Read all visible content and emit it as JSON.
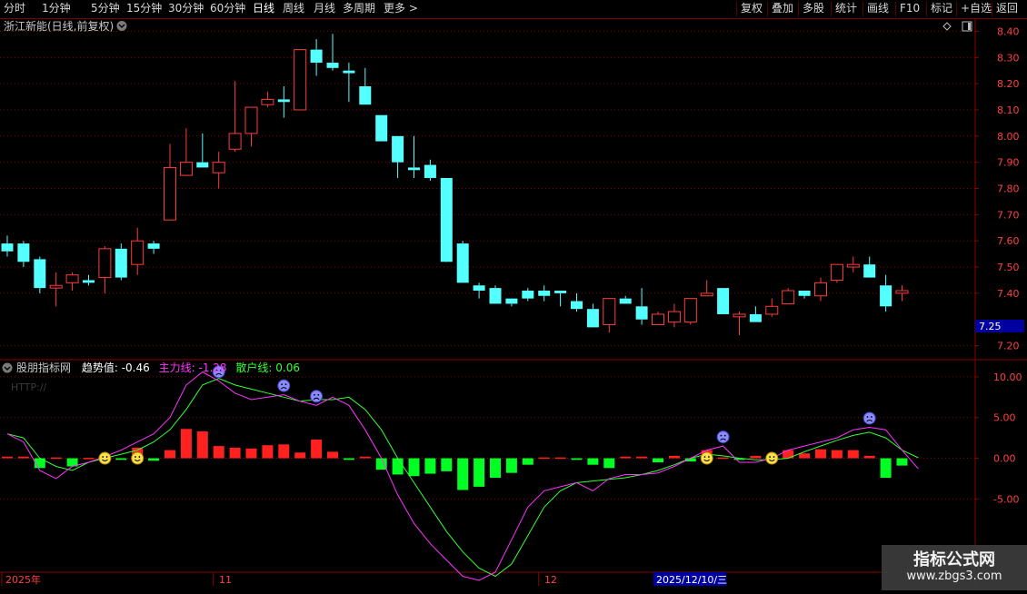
{
  "toolbar": {
    "periods": [
      "分时",
      "1分钟",
      "5分钟",
      "15分钟",
      "30分钟",
      "60分钟",
      "日线",
      "周线",
      "月线",
      "多周期",
      "更多 >"
    ],
    "active_period": "日线",
    "right_buttons": [
      "复权",
      "叠加",
      "多股",
      "统计",
      "画线",
      "F10",
      "标记",
      "+自选",
      "返回"
    ]
  },
  "main_panel": {
    "stock_title": "浙江新能(日线,前复权)",
    "price_ticks": [
      "8.40",
      "8.30",
      "8.20",
      "8.10",
      "8.00",
      "7.90",
      "7.80",
      "7.70",
      "7.60",
      "7.50",
      "7.40",
      "7.20"
    ],
    "current_price_tag": "7.25"
  },
  "indicator_panel": {
    "name": "股朋指标网",
    "trend_label": "趋势值:",
    "trend_value": "-0.46",
    "main_label": "主力线:",
    "main_value": "-1.28",
    "retail_label": "散户线:",
    "retail_value": "0.06",
    "watermark_text": "HTTP://",
    "ticks": [
      "10.00",
      "5.00",
      "0.00",
      "-5.00"
    ]
  },
  "x_axis": {
    "labels": [
      "2025年",
      "11",
      "12"
    ],
    "cursor_date": "2025/12/10/三"
  },
  "watermark": {
    "title": "指标公式网",
    "url": "www.zbgs3.com"
  },
  "colors": {
    "up": "#ff3c3c",
    "down": "#54ffff",
    "grid": "#8a0000",
    "main_line": "#ff33ff",
    "retail_line": "#33ff33",
    "bar_up": "#ff2020",
    "bar_down": "#00ff22"
  },
  "chart_data": {
    "type": "candlestick",
    "ohlc": [
      [
        7.59,
        7.62,
        7.54,
        7.56
      ],
      [
        7.59,
        7.6,
        7.5,
        7.52
      ],
      [
        7.53,
        7.54,
        7.4,
        7.42
      ],
      [
        7.42,
        7.48,
        7.35,
        7.43
      ],
      [
        7.44,
        7.48,
        7.41,
        7.47
      ],
      [
        7.45,
        7.47,
        7.43,
        7.44
      ],
      [
        7.46,
        7.58,
        7.4,
        7.57
      ],
      [
        7.57,
        7.59,
        7.45,
        7.46
      ],
      [
        7.51,
        7.65,
        7.47,
        7.6
      ],
      [
        7.59,
        7.6,
        7.55,
        7.57
      ],
      [
        7.68,
        7.97,
        7.68,
        7.88
      ],
      [
        7.85,
        8.03,
        7.85,
        7.9
      ],
      [
        7.9,
        8.01,
        7.88,
        7.88
      ],
      [
        7.86,
        7.94,
        7.8,
        7.9
      ],
      [
        7.95,
        8.21,
        7.94,
        8.01
      ],
      [
        8.01,
        8.11,
        7.96,
        8.11
      ],
      [
        8.12,
        8.17,
        8.11,
        8.14
      ],
      [
        8.14,
        8.19,
        8.07,
        8.13
      ],
      [
        8.1,
        8.32,
        8.1,
        8.33
      ],
      [
        8.33,
        8.37,
        8.23,
        8.28
      ],
      [
        8.28,
        8.39,
        8.25,
        8.26
      ],
      [
        8.25,
        8.28,
        8.13,
        8.24
      ],
      [
        8.19,
        8.26,
        8.12,
        8.12
      ],
      [
        8.08,
        8.08,
        7.98,
        7.98
      ],
      [
        8.0,
        8.0,
        7.84,
        7.9
      ],
      [
        7.88,
        8.0,
        7.84,
        7.87
      ],
      [
        7.89,
        7.91,
        7.83,
        7.84
      ],
      [
        7.84,
        7.84,
        7.53,
        7.52
      ],
      [
        7.59,
        7.6,
        7.44,
        7.44
      ],
      [
        7.43,
        7.44,
        7.38,
        7.41
      ],
      [
        7.42,
        7.43,
        7.36,
        7.36
      ],
      [
        7.38,
        7.38,
        7.35,
        7.36
      ],
      [
        7.41,
        7.42,
        7.37,
        7.38
      ],
      [
        7.41,
        7.43,
        7.37,
        7.39
      ],
      [
        7.41,
        7.41,
        7.35,
        7.4
      ],
      [
        7.37,
        7.4,
        7.33,
        7.34
      ],
      [
        7.34,
        7.36,
        7.27,
        7.27
      ],
      [
        7.28,
        7.38,
        7.25,
        7.38
      ],
      [
        7.38,
        7.39,
        7.36,
        7.36
      ],
      [
        7.35,
        7.42,
        7.28,
        7.3
      ],
      [
        7.28,
        7.33,
        7.28,
        7.32
      ],
      [
        7.29,
        7.36,
        7.27,
        7.33
      ],
      [
        7.29,
        7.38,
        7.28,
        7.38
      ],
      [
        7.39,
        7.45,
        7.39,
        7.4
      ],
      [
        7.42,
        7.42,
        7.32,
        7.32
      ],
      [
        7.31,
        7.33,
        7.24,
        7.32
      ],
      [
        7.32,
        7.35,
        7.29,
        7.29
      ],
      [
        7.32,
        7.38,
        7.31,
        7.35
      ],
      [
        7.36,
        7.42,
        7.36,
        7.41
      ],
      [
        7.41,
        7.41,
        7.38,
        7.39
      ],
      [
        7.39,
        7.46,
        7.37,
        7.44
      ],
      [
        7.45,
        7.51,
        7.44,
        7.51
      ],
      [
        7.5,
        7.54,
        7.48,
        7.51
      ],
      [
        7.51,
        7.54,
        7.46,
        7.46
      ],
      [
        7.43,
        7.47,
        7.33,
        7.35
      ],
      [
        7.4,
        7.43,
        7.37,
        7.41
      ]
    ],
    "trend_bars": [
      0.2,
      0.2,
      -1.2,
      0.1,
      -1.0,
      0.05,
      0.3,
      -0.2,
      1.3,
      -0.3,
      1.0,
      3.6,
      3.3,
      1.5,
      1.3,
      1.2,
      1.6,
      1.7,
      0.7,
      2.3,
      0.8,
      -0.2,
      0.2,
      -1.4,
      -2.0,
      -2.2,
      -1.9,
      -1.6,
      -3.9,
      -3.5,
      -2.4,
      -1.8,
      -0.8,
      0.1,
      0.1,
      -0.2,
      -0.8,
      -1.2,
      0.2,
      0.2,
      -0.5,
      0.3,
      -0.4,
      1.0,
      0.1,
      -0.2,
      0.3,
      0.3,
      1.0,
      0.6,
      1.1,
      1.0,
      1.0,
      0.3,
      -2.4,
      -0.9
    ],
    "main_line": [
      3.0,
      2.0,
      -1.5,
      -2.5,
      -1.0,
      -0.5,
      0.2,
      1.0,
      2.0,
      3.0,
      5.0,
      9.0,
      10.6,
      9.5,
      8.0,
      7.2,
      7.5,
      7.8,
      7.0,
      6.5,
      7.5,
      6.5,
      3.5,
      0,
      -4.5,
      -8,
      -10.5,
      -12.5,
      -14.5,
      -15.0,
      -14.0,
      -10,
      -6,
      -4,
      -3.5,
      -3.0,
      -4.0,
      -2.5,
      -2.0,
      -2.0,
      -1.8,
      -1.0,
      0,
      1.0,
      1.5,
      -0.5,
      -0.5,
      0,
      1.0,
      1.5,
      2.0,
      2.5,
      3.5,
      3.8,
      3.5,
      1.0,
      -1.3
    ],
    "retail_line": [
      3.0,
      2.5,
      0,
      -1.0,
      -1.5,
      -0.5,
      0,
      0.5,
      1.0,
      2.0,
      3.5,
      6.0,
      9.0,
      9.8,
      9.0,
      8.5,
      8.0,
      7.5,
      7.0,
      7.2,
      7.2,
      7.5,
      6.0,
      3.5,
      0,
      -3.0,
      -6.0,
      -9.0,
      -11.5,
      -13.5,
      -14.5,
      -13.0,
      -9.5,
      -6.0,
      -4.0,
      -3.0,
      -2.8,
      -2.6,
      -2.4,
      -2.0,
      -1.5,
      -0.8,
      0,
      0.5,
      0.3,
      0,
      -0.2,
      -0.2,
      0,
      0.8,
      1.5,
      2.2,
      2.8,
      3.2,
      2.5,
      1.0,
      0.06
    ],
    "smile_markers": [
      6,
      8,
      43,
      47
    ],
    "frown_markers": [
      13,
      17,
      19,
      44,
      53
    ],
    "price_ylim": [
      7.15,
      8.45
    ],
    "indicator_ylim": [
      -14,
      12
    ]
  }
}
